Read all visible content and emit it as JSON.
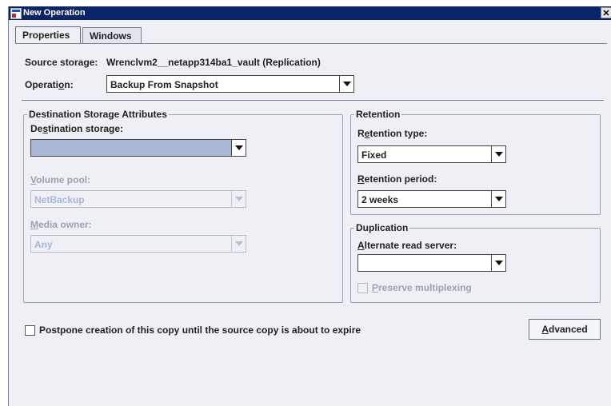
{
  "window": {
    "title": "New Operation",
    "close_label": "✕"
  },
  "tabs": [
    {
      "label": "Properties"
    },
    {
      "label": "Windows"
    }
  ],
  "source": {
    "label": "Source storage:",
    "value": "Wrenclvm2__netapp314ba1_vault (Replication)"
  },
  "operation": {
    "label_pre": "Operati",
    "label_u": "o",
    "label_post": "n:",
    "value": "Backup From Snapshot"
  },
  "destination": {
    "group_title": "Destination Storage Attributes",
    "storage_label_pre": "De",
    "storage_label_u": "s",
    "storage_label_post": "tination storage:",
    "storage_value": "",
    "volume_pool_label_u": "V",
    "volume_pool_label_post": "olume pool:",
    "volume_pool_value": "NetBackup",
    "media_owner_label_u": "M",
    "media_owner_label_post": "edia owner:",
    "media_owner_value": "Any"
  },
  "retention": {
    "group_title": "Retention",
    "type_label_pre": "R",
    "type_label_u": "e",
    "type_label_post": "tention type:",
    "type_value": "Fixed",
    "period_label_u": "R",
    "period_label_post": "etention period:",
    "period_value": "2 weeks"
  },
  "duplication": {
    "group_title": "Duplication",
    "server_label_u": "A",
    "server_label_post": "lternate read server:",
    "server_value": "",
    "preserve_label_u": "P",
    "preserve_label_post": "reserve multiplexing"
  },
  "postpone": {
    "label": "Postpone creation of this copy until the source copy is about to expire"
  },
  "advanced_button": {
    "label_u": "A",
    "label_post": "dvanced"
  }
}
